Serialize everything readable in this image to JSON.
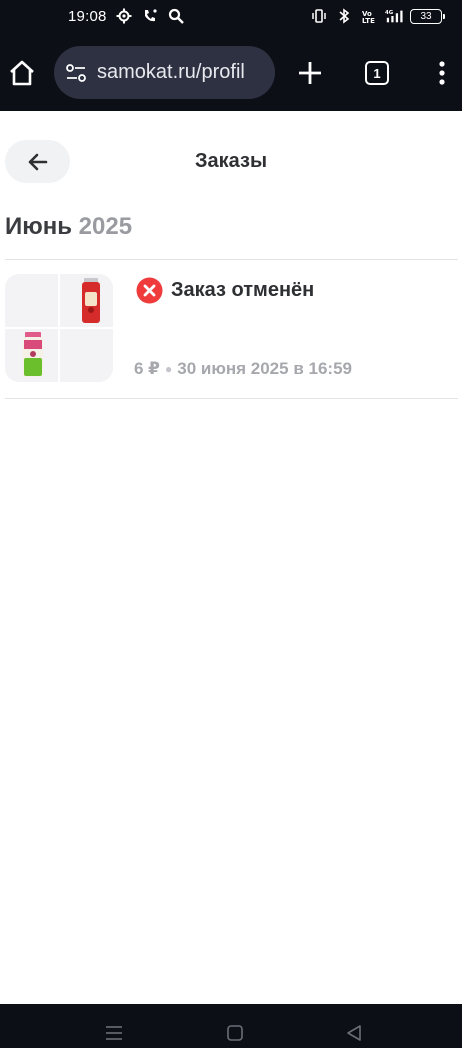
{
  "status_bar": {
    "time": "19:08",
    "battery": "33",
    "network": "4G"
  },
  "browser": {
    "url": "samokat.ru/profil",
    "tab_count": "1",
    "icons": [
      "home-icon",
      "site-settings-icon",
      "plus-icon",
      "tabs-icon",
      "more-vert-icon"
    ]
  },
  "header": {
    "title": "Заказы",
    "back_icon": "arrow-left-icon"
  },
  "month_group": {
    "month": "Июнь",
    "year": "2025"
  },
  "orders": [
    {
      "status": "Заказ отменён",
      "price": "6 ₽",
      "date": "30 июня 2025 в 16:59",
      "status_color": "#ef3b3b"
    }
  ],
  "colors": {
    "chrome_dark": "#0d0f16",
    "url_box": "#2e3142",
    "status_cancelled": "#ef3b3b",
    "muted_text": "#a7a8ad"
  }
}
